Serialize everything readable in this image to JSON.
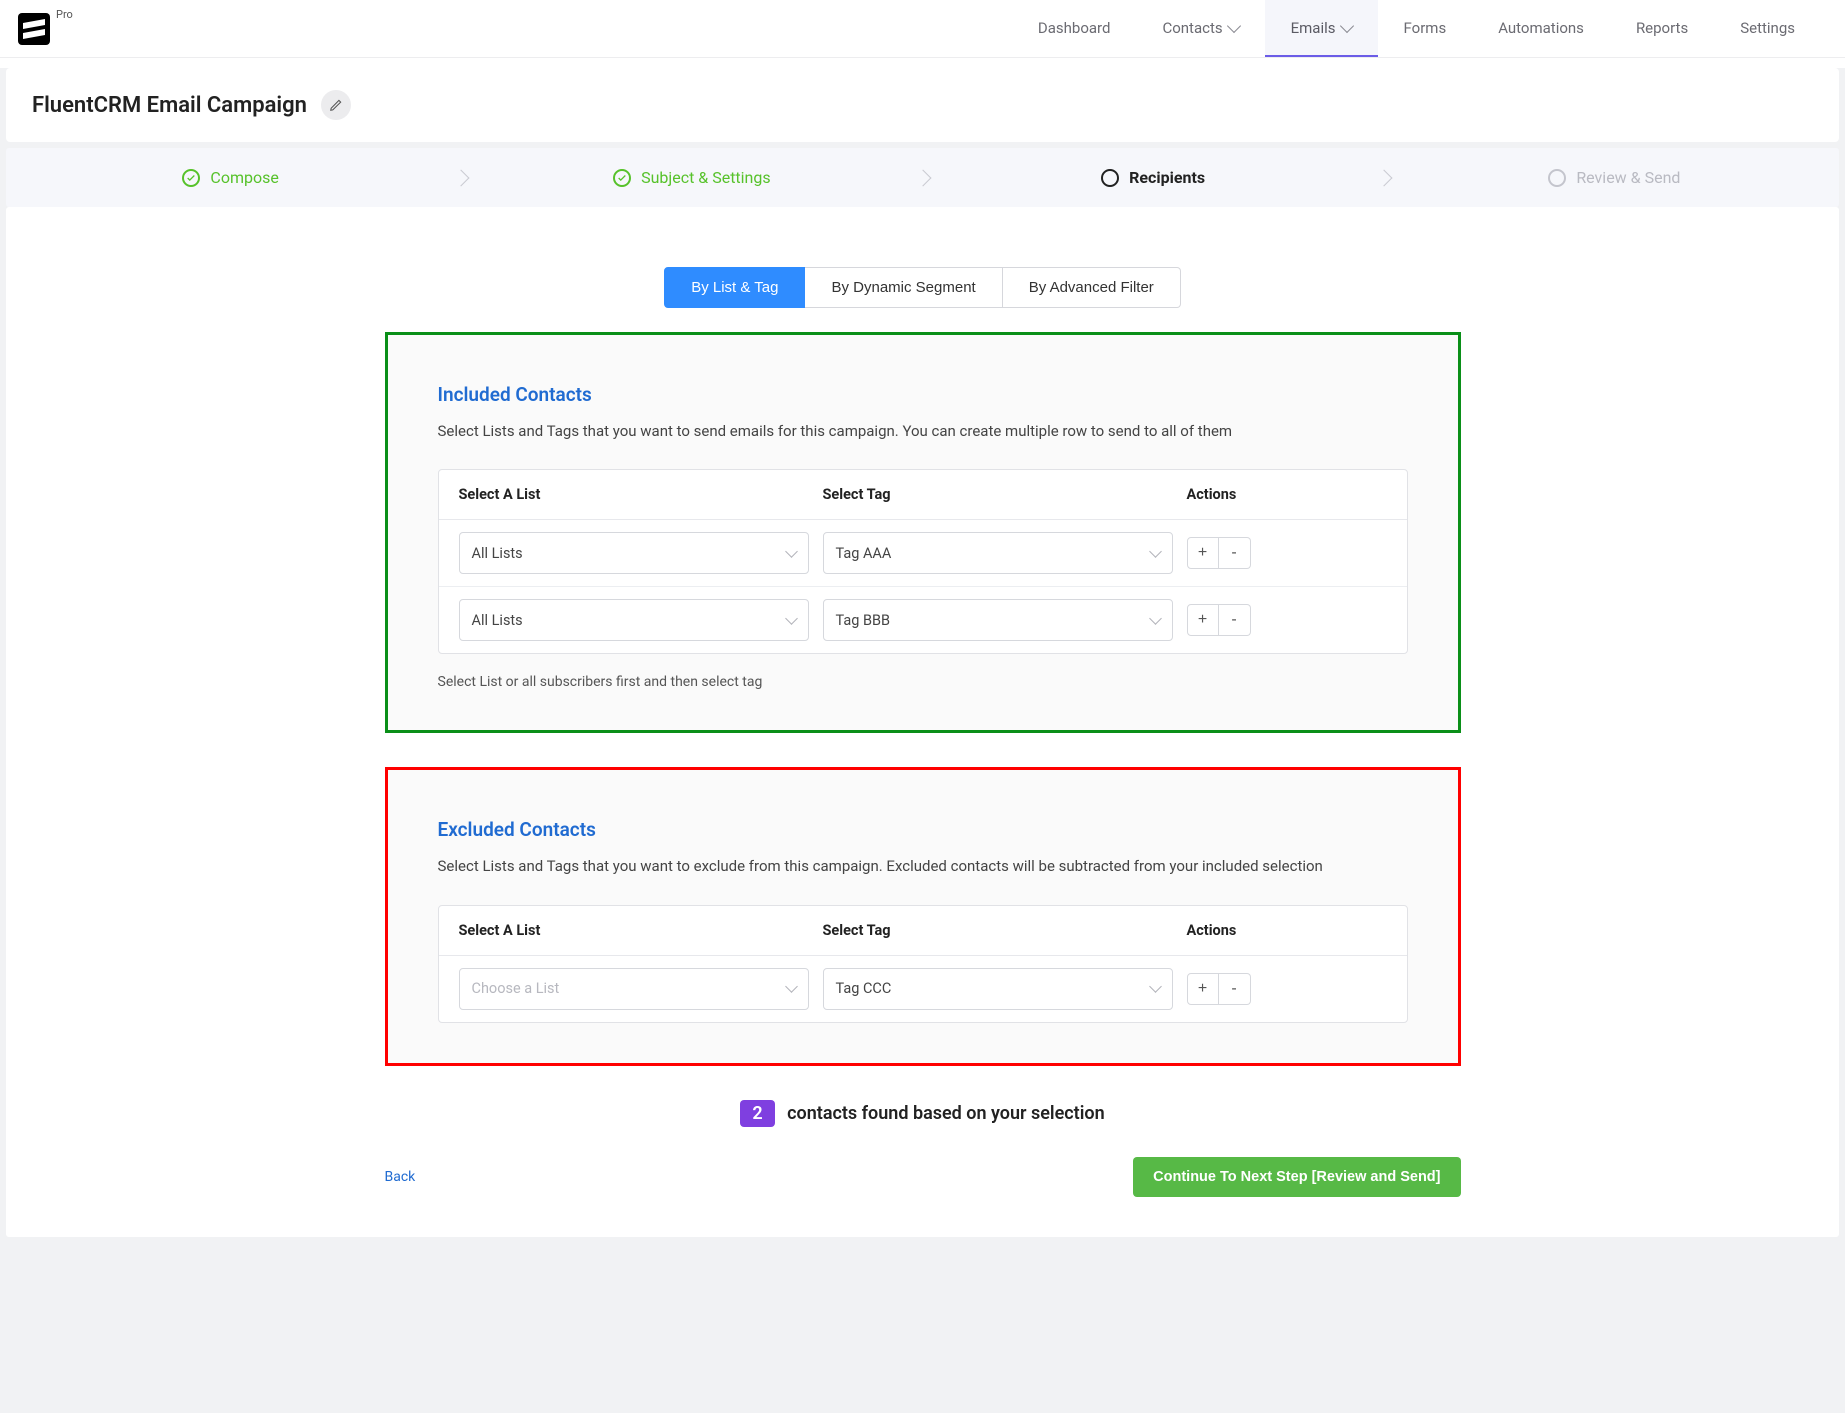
{
  "pro_label": "Pro",
  "nav": {
    "dashboard": "Dashboard",
    "contacts": "Contacts",
    "emails": "Emails",
    "forms": "Forms",
    "automations": "Automations",
    "reports": "Reports",
    "settings": "Settings"
  },
  "campaign_title": "FluentCRM Email Campaign",
  "steps": {
    "compose": "Compose",
    "subject": "Subject & Settings",
    "recipients": "Recipients",
    "review": "Review & Send"
  },
  "filter_tabs": {
    "by_list": "By List & Tag",
    "by_segment": "By Dynamic Segment",
    "by_advanced": "By Advanced Filter"
  },
  "included": {
    "title": "Included Contacts",
    "desc": "Select Lists and Tags that you want to send emails for this campaign. You can create multiple row to send to all of them",
    "headers": {
      "list": "Select A List",
      "tag": "Select Tag",
      "actions": "Actions"
    },
    "rows": [
      {
        "list": "All Lists",
        "tag": "Tag AAA"
      },
      {
        "list": "All Lists",
        "tag": "Tag BBB"
      }
    ],
    "hint": "Select List or all subscribers first and then select tag"
  },
  "excluded": {
    "title": "Excluded Contacts",
    "desc": "Select Lists and Tags that you want to exclude from this campaign. Excluded contacts will be subtracted from your included selection",
    "headers": {
      "list": "Select A List",
      "tag": "Select Tag",
      "actions": "Actions"
    },
    "rows": [
      {
        "list_placeholder": "Choose a List",
        "tag": "Tag CCC"
      }
    ]
  },
  "found": {
    "count": "2",
    "text": "contacts found based on your selection"
  },
  "buttons": {
    "back": "Back",
    "continue": "Continue To Next Step [Review and Send]",
    "plus": "+",
    "minus": "-"
  }
}
